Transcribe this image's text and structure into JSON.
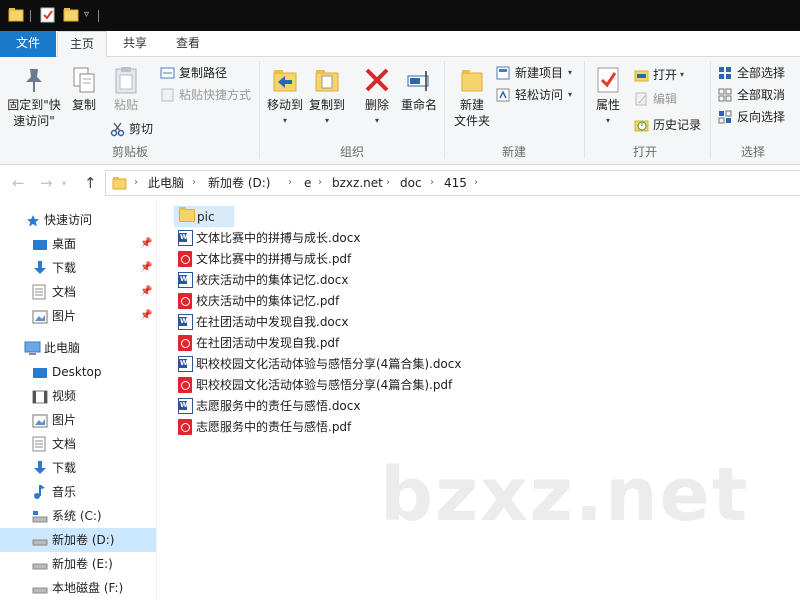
{
  "ribbon_tabs": {
    "file": "文件",
    "home": "主页",
    "share": "共享",
    "view": "查看"
  },
  "ribbon": {
    "clipboard": {
      "pin_label_line1": "固定到\"快",
      "pin_label_line2": "速访问\"",
      "copy": "复制",
      "paste": "粘贴",
      "copy_path": "复制路径",
      "paste_shortcut": "粘贴快捷方式",
      "cut": "剪切",
      "group_label": "剪贴板"
    },
    "organize": {
      "move_to": "移动到",
      "copy_to": "复制到",
      "delete": "删除",
      "rename": "重命名",
      "group_label": "组织"
    },
    "new": {
      "new_folder_line1": "新建",
      "new_folder_line2": "文件夹",
      "new_item": "新建项目",
      "easy_access": "轻松访问",
      "group_label": "新建"
    },
    "open": {
      "properties": "属性",
      "open": "打开",
      "edit": "编辑",
      "history": "历史记录",
      "group_label": "打开"
    },
    "select": {
      "select_all": "全部选择",
      "select_none": "全部取消",
      "invert": "反向选择",
      "group_label": "选择"
    }
  },
  "address": {
    "breadcrumbs": [
      "此电脑",
      "新加卷 (D:)",
      "e",
      "bzxz.net",
      "doc",
      "415"
    ]
  },
  "nav": {
    "quick_access": "快速访问",
    "quick_items": [
      "桌面",
      "下载",
      "文档",
      "图片"
    ],
    "this_pc": "此电脑",
    "pc_items": [
      "Desktop",
      "视频",
      "图片",
      "文档",
      "下载",
      "音乐",
      "系统 (C:)",
      "新加卷 (D:)",
      "新加卷 (E:)",
      "本地磁盘 (F:)"
    ]
  },
  "files": [
    {
      "name": "pic",
      "type": "folder"
    },
    {
      "name": "文体比赛中的拼搏与成长.docx",
      "type": "docx"
    },
    {
      "name": "文体比赛中的拼搏与成长.pdf",
      "type": "pdf"
    },
    {
      "name": "校庆活动中的集体记忆.docx",
      "type": "docx"
    },
    {
      "name": "校庆活动中的集体记忆.pdf",
      "type": "pdf"
    },
    {
      "name": "在社团活动中发现自我.docx",
      "type": "docx"
    },
    {
      "name": "在社团活动中发现自我.pdf",
      "type": "pdf"
    },
    {
      "name": "职校校园文化活动体验与感悟分享(4篇合集).docx",
      "type": "docx"
    },
    {
      "name": "职校校园文化活动体验与感悟分享(4篇合集).pdf",
      "type": "pdf"
    },
    {
      "name": "志愿服务中的责任与感悟.docx",
      "type": "docx"
    },
    {
      "name": "志愿服务中的责任与感悟.pdf",
      "type": "pdf"
    }
  ],
  "watermark": "bzxz.net",
  "colors": {
    "file_tab": "#1979ca",
    "selection": "#cce8ff",
    "folder": "#f7d36b",
    "pdf": "#e0262c",
    "word": "#2b5797"
  }
}
